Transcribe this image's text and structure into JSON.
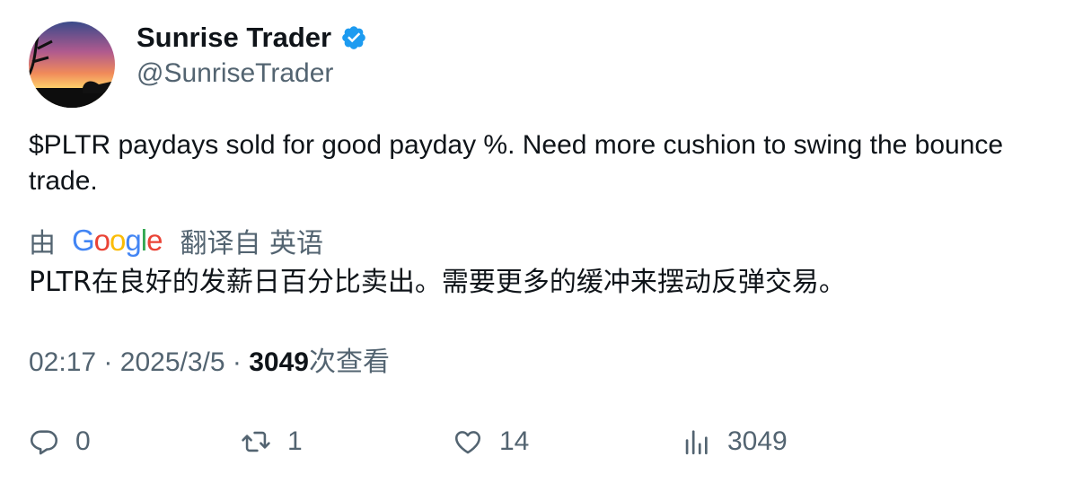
{
  "author": {
    "name": "Sunrise Trader",
    "handle": "@SunriseTrader",
    "verified": true,
    "verified_color": "#1d9bf0"
  },
  "tweet": {
    "text": "$PLTR paydays sold for good payday %.  Need more cushion to swing the bounce trade."
  },
  "translation": {
    "prefix": "由",
    "provider": "Google",
    "suffix": "翻译自 英语",
    "text": "PLTR在良好的发薪日百分比卖出。需要更多的缓冲来摆动反弹交易。"
  },
  "meta": {
    "time": "02:17",
    "separator": "·",
    "date": "2025/3/5",
    "views": "3049",
    "views_label": "次查看"
  },
  "actions": {
    "replies": "0",
    "reposts": "1",
    "likes": "14",
    "views": "3049"
  },
  "icons": [
    "reply-icon",
    "repost-icon",
    "like-icon",
    "views-icon",
    "verified-badge-icon"
  ],
  "colors": {
    "text": "#0f1419",
    "secondary": "#536471",
    "google_blue": "#4285f4",
    "google_red": "#ea4335",
    "google_yellow": "#fbbc05",
    "google_green": "#34a853"
  }
}
